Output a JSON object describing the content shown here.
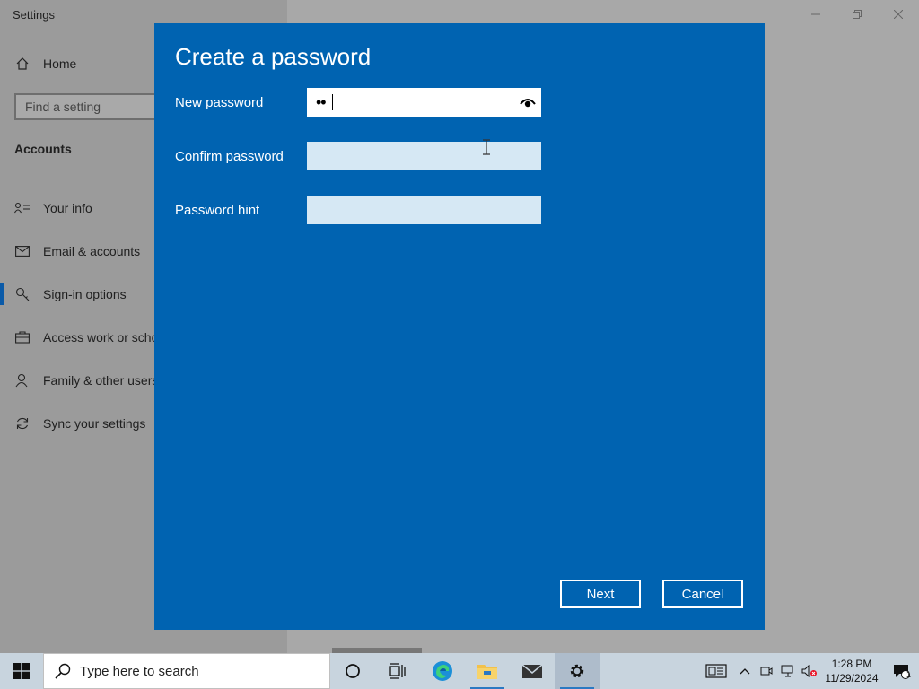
{
  "window": {
    "title": "Settings"
  },
  "sidebar": {
    "home_label": "Home",
    "search_placeholder": "Find a setting",
    "section_title": "Accounts",
    "items": [
      {
        "label": "Your info",
        "icon": "person-card-icon"
      },
      {
        "label": "Email & accounts",
        "icon": "mail-icon"
      },
      {
        "label": "Sign-in options",
        "icon": "key-icon",
        "active": true
      },
      {
        "label": "Access work or scho",
        "icon": "briefcase-icon"
      },
      {
        "label": "Family & other users",
        "icon": "person-add-icon"
      },
      {
        "label": "Sync your settings",
        "icon": "sync-icon"
      }
    ]
  },
  "dialog": {
    "title": "Create a password",
    "new_password_label": "New password",
    "new_password_value": "••",
    "confirm_password_label": "Confirm password",
    "password_hint_label": "Password hint",
    "next_label": "Next",
    "cancel_label": "Cancel"
  },
  "taskbar": {
    "search_placeholder": "Type here to search",
    "time": "1:28 PM",
    "date": "11/29/2024",
    "notification_count": "1"
  },
  "colors": {
    "dialog_bg": "#0063b1",
    "field_inactive": "#d6e8f4",
    "accent": "#0a5aa8"
  }
}
